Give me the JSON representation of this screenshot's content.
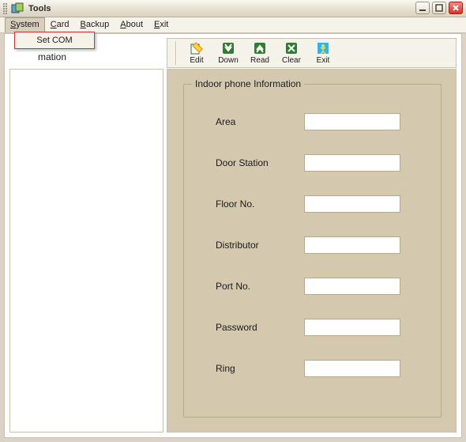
{
  "window": {
    "title": "Tools"
  },
  "menubar": {
    "items": [
      {
        "label": "System",
        "underline_index": 0
      },
      {
        "label": "Card",
        "underline_index": 0
      },
      {
        "label": "Backup",
        "underline_index": 0
      },
      {
        "label": "About",
        "underline_index": 0
      },
      {
        "label": "Exit",
        "underline_index": 0
      }
    ]
  },
  "dropdown": {
    "parent": "System",
    "items": [
      {
        "label": "Set COM"
      }
    ]
  },
  "sub_title": "mation",
  "toolbar": {
    "buttons": [
      {
        "id": "edit",
        "label": "Edit"
      },
      {
        "id": "down",
        "label": "Down"
      },
      {
        "id": "read",
        "label": "Read"
      },
      {
        "id": "clear",
        "label": "Clear"
      },
      {
        "id": "exit",
        "label": "Exit"
      }
    ]
  },
  "form": {
    "legend": "Indoor phone Information",
    "fields": {
      "area": {
        "label": "Area",
        "value": ""
      },
      "door_station": {
        "label": "Door Station",
        "value": ""
      },
      "floor_no": {
        "label": "Floor No.",
        "value": ""
      },
      "distributor": {
        "label": "Distributor",
        "value": ""
      },
      "port_no": {
        "label": "Port No.",
        "value": ""
      },
      "password": {
        "label": "Password",
        "value": ""
      },
      "ring": {
        "label": "Ring",
        "value": ""
      }
    }
  }
}
